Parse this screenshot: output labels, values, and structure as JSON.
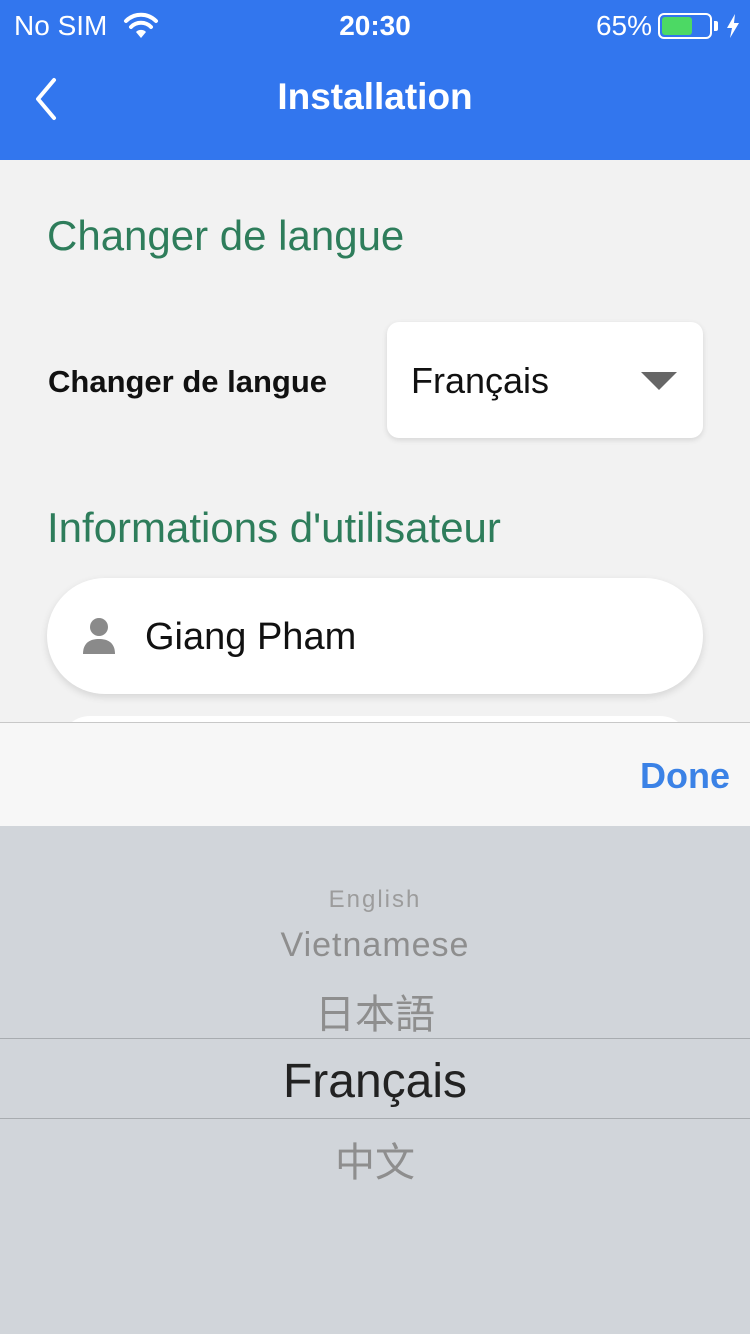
{
  "status_bar": {
    "carrier": "No SIM",
    "time": "20:30",
    "battery_percent": "65%",
    "battery_level": 0.65
  },
  "nav": {
    "title": "Installation",
    "color": "#3276ee"
  },
  "section_language": {
    "title": "Changer de langue",
    "label": "Changer de langue",
    "selected": "Français"
  },
  "section_user": {
    "title": "Informations d'utilisateur",
    "name": "Giang Pham"
  },
  "picker": {
    "done_label": "Done",
    "options": [
      "English",
      "Vietnamese",
      "日本語",
      "Français",
      "中文"
    ],
    "selected_index": 3
  }
}
